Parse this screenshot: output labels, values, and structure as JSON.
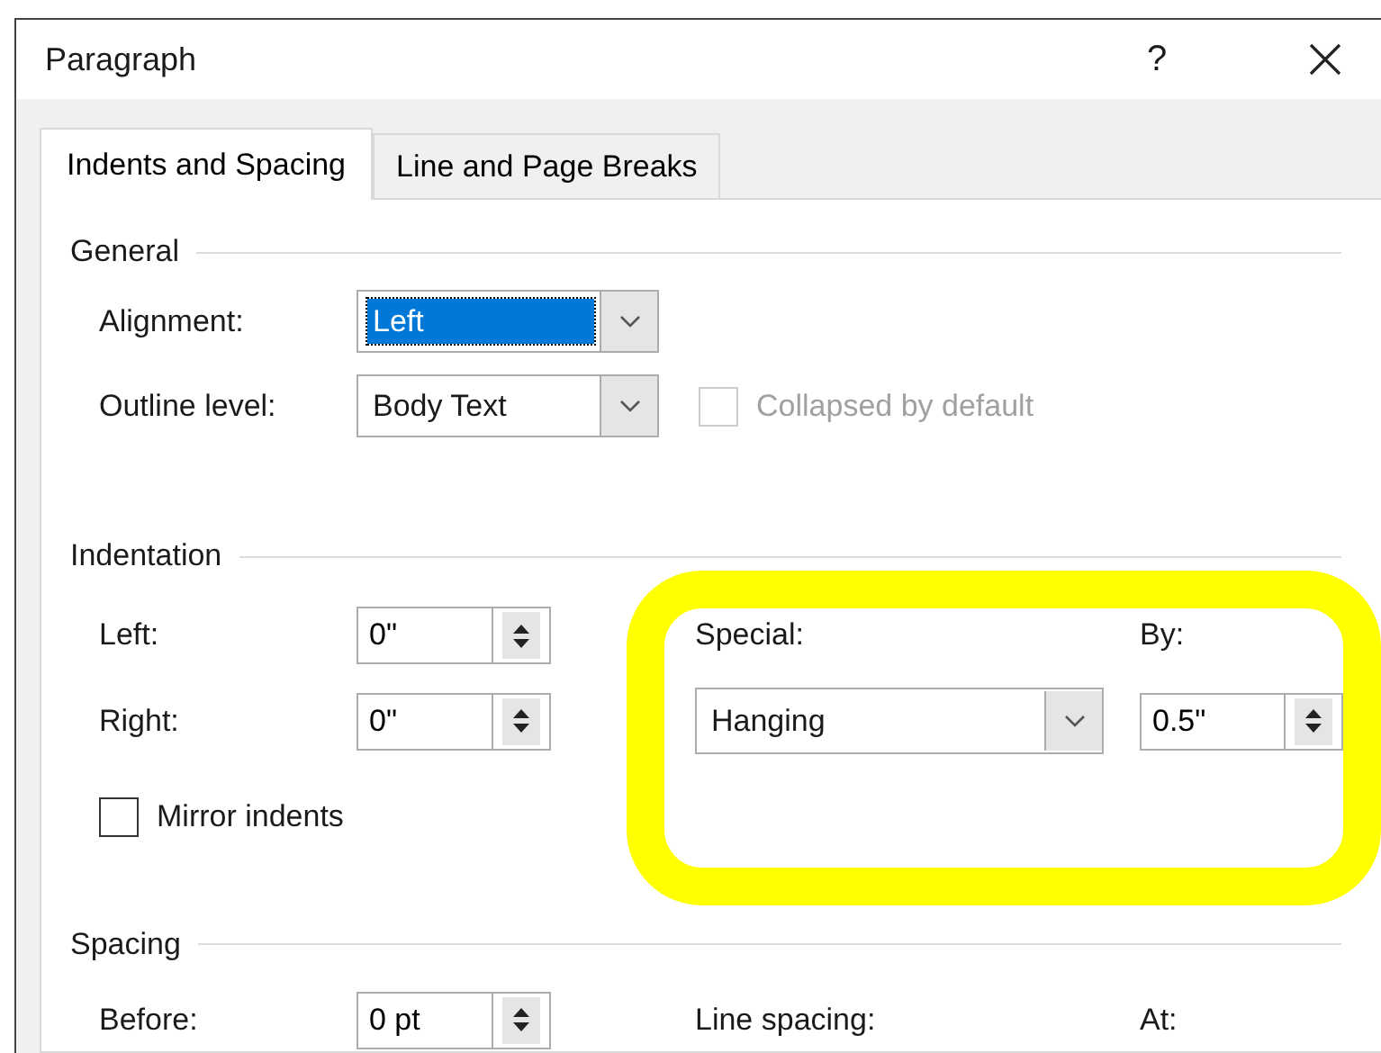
{
  "window": {
    "title": "Paragraph",
    "help": "?"
  },
  "tabs": [
    {
      "label": "Indents and Spacing",
      "selected": true
    },
    {
      "label": "Line and Page Breaks",
      "selected": false
    }
  ],
  "general": {
    "title": "General",
    "alignment": {
      "label": "Alignment:",
      "value": "Left",
      "focused": true
    },
    "outline_level": {
      "label": "Outline level:",
      "value": "Body Text",
      "focused": false
    },
    "collapsed": {
      "label": "Collapsed by default",
      "checked": false,
      "disabled": true
    }
  },
  "indentation": {
    "title": "Indentation",
    "left": {
      "label": "Left:",
      "value": "0\""
    },
    "right": {
      "label": "Right:",
      "value": "0\""
    },
    "special": {
      "label": "Special:",
      "value": "Hanging",
      "focused": false
    },
    "by": {
      "label": "By:",
      "value": "0.5\""
    },
    "mirror": {
      "label": "Mirror indents",
      "checked": false,
      "disabled": false
    }
  },
  "spacing": {
    "title": "Spacing",
    "before": {
      "label": "Before:",
      "value": "0 pt"
    },
    "line_spacing": {
      "label": "Line spacing:"
    },
    "at": {
      "label": "At:"
    }
  }
}
